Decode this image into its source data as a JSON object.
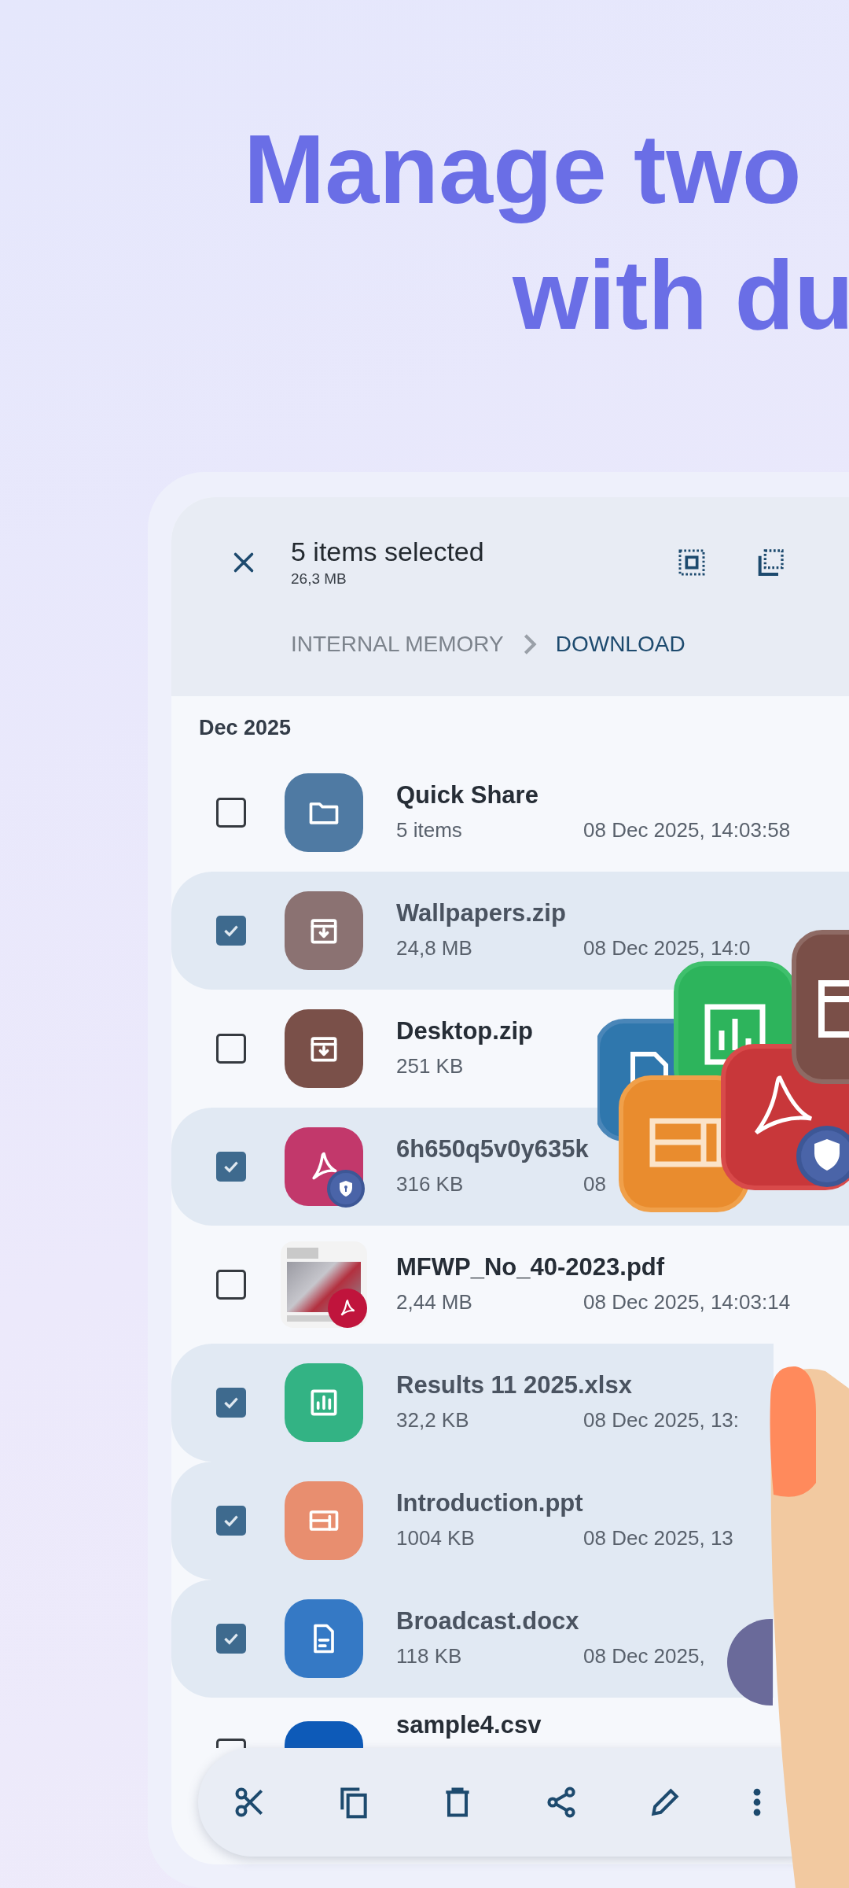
{
  "headline": [
    "Manage two",
    "with du"
  ],
  "app": {
    "selection": {
      "title": "5 items selected",
      "size": "26,3 MB"
    },
    "breadcrumb": [
      {
        "label": "INTERNAL MEMORY",
        "selected": false
      },
      {
        "label": "DOWNLOAD",
        "selected": true
      }
    ],
    "section": "Dec 2025",
    "files": [
      {
        "name": "Quick Share",
        "detail": "5 items",
        "date": "08 Dec 2025, 14:03:58",
        "kind": "folder",
        "color": "#4f7aa3",
        "checked": false
      },
      {
        "name": "Wallpapers.zip",
        "detail": "24,8 MB",
        "date": "08 Dec 2025, 14:0",
        "kind": "archive",
        "color": "#8b7272",
        "checked": true
      },
      {
        "name": "Desktop.zip",
        "detail": "251 KB",
        "kind": "archive",
        "color": "#7a5049",
        "checked": false
      },
      {
        "name": "6h650q5v0y635k",
        "detail": "316 KB",
        "date": "08",
        "kind": "locked-pdf",
        "color": "#c2386b",
        "checked": true
      },
      {
        "name": "MFWP_No_40-2023.pdf",
        "detail": "2,44 MB",
        "date": "08 Dec 2025, 14:03:14",
        "kind": "pdf-preview",
        "color": "#c0143c",
        "checked": false
      },
      {
        "name": "Results 11 2025.xlsx",
        "detail": "32,2 KB",
        "date": "08 Dec 2025, 13:",
        "kind": "sheet",
        "color": "#33b384",
        "checked": true
      },
      {
        "name": "Introduction.ppt",
        "detail": "1004 KB",
        "date": "08 Dec 2025, 13",
        "kind": "slides",
        "color": "#e88e6f",
        "checked": true
      },
      {
        "name": "Broadcast.docx",
        "detail": "118 KB",
        "date": "08 Dec 2025,",
        "kind": "doc",
        "color": "#3579c5",
        "checked": true
      },
      {
        "name": "sample4.csv",
        "color": "#0d5ab8",
        "checked": false
      }
    ]
  }
}
